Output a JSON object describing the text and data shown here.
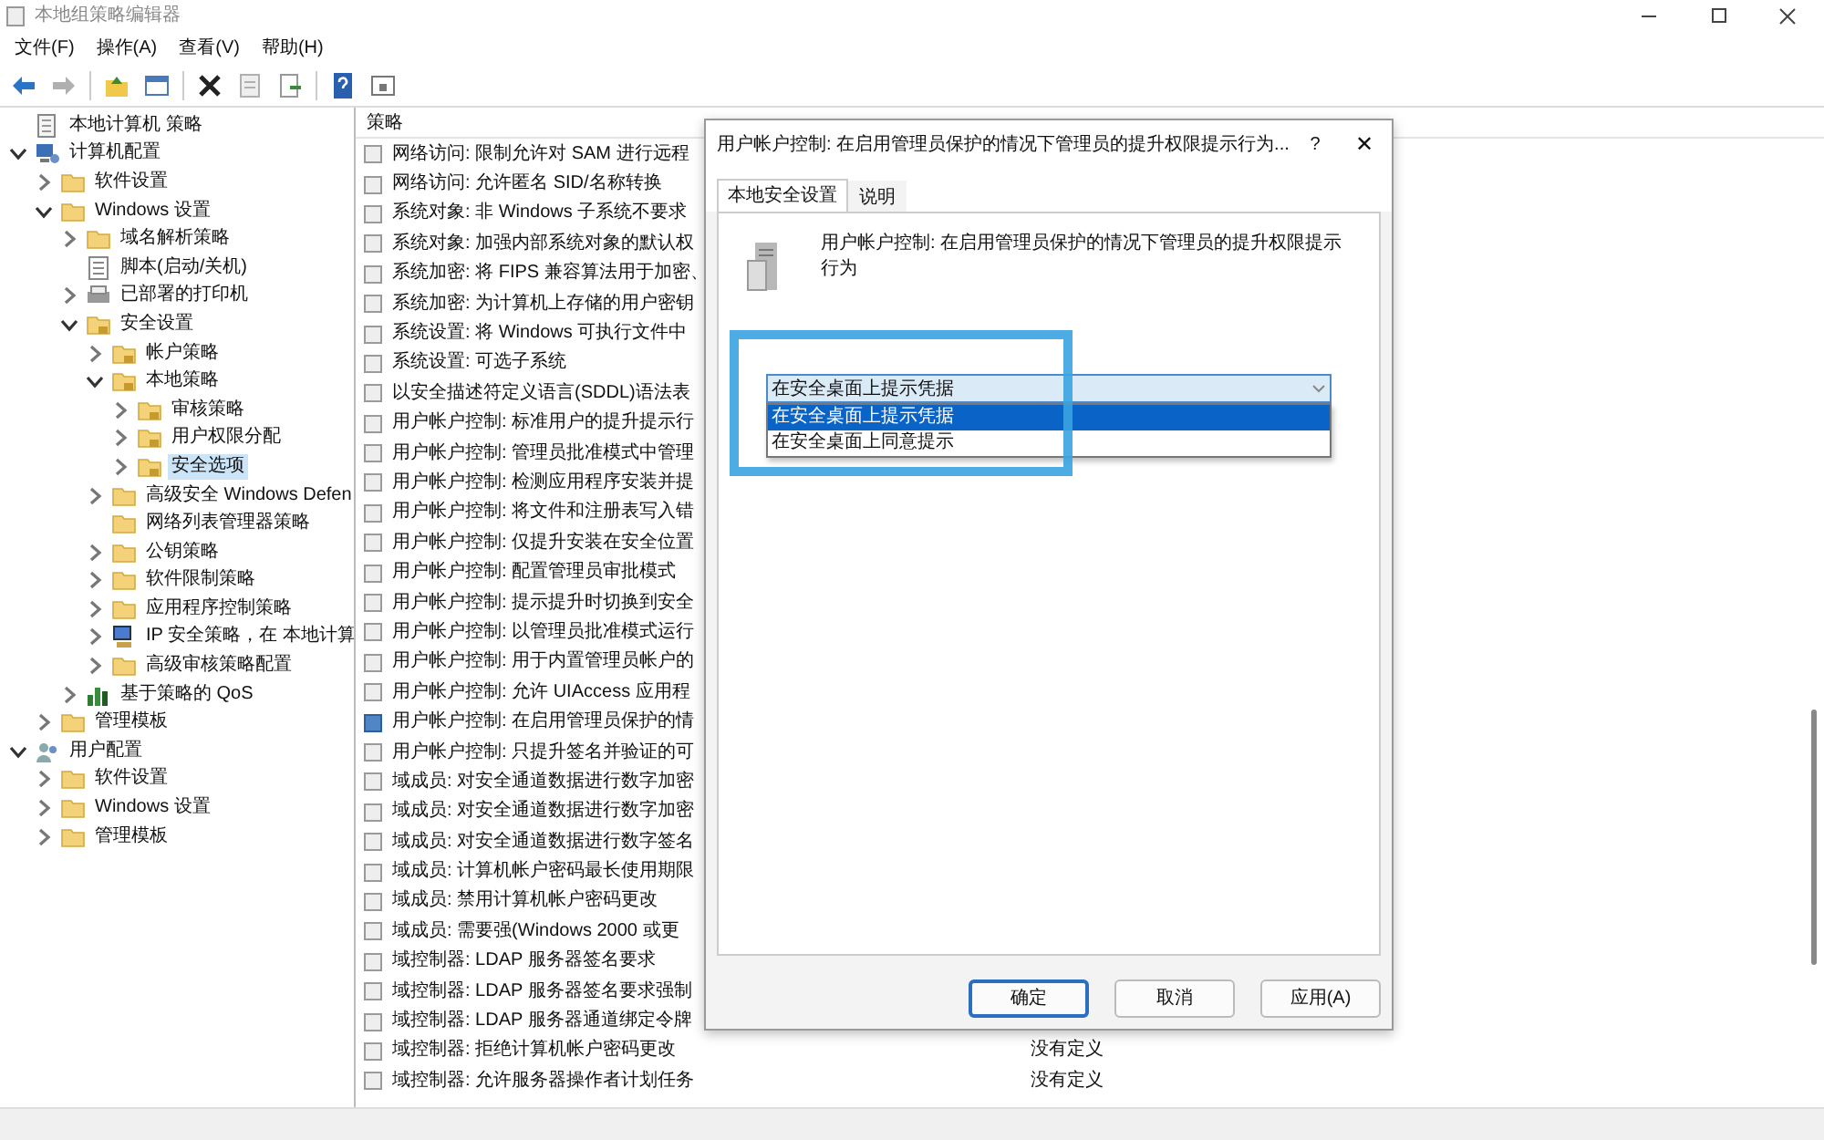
{
  "window": {
    "title": "本地组策略编辑器"
  },
  "menu": [
    "文件(F)",
    "操作(A)",
    "查看(V)",
    "帮助(H)"
  ],
  "toolbar": [
    {
      "kind": "back"
    },
    {
      "kind": "forward"
    },
    {
      "kind": "sep"
    },
    {
      "kind": "up"
    },
    {
      "kind": "tree"
    },
    {
      "kind": "sep"
    },
    {
      "kind": "delete"
    },
    {
      "kind": "properties"
    },
    {
      "kind": "export"
    },
    {
      "kind": "sep"
    },
    {
      "kind": "help"
    },
    {
      "kind": "pane"
    }
  ],
  "tree": [
    {
      "label": "本地计算机 策略",
      "kind": "policy",
      "selected": false
    },
    {
      "label": "计算机配置",
      "kind": "computer",
      "has_children": true,
      "expanded": true,
      "selected": false,
      "children": [
        {
          "label": "软件设置",
          "kind": "folder",
          "has_children": true,
          "expanded": false,
          "selected": false
        },
        {
          "label": "Windows 设置",
          "kind": "folder",
          "has_children": true,
          "expanded": true,
          "selected": false,
          "children": [
            {
              "label": "域名解析策略",
              "kind": "folder",
              "has_children": true,
              "expanded": false,
              "selected": false
            },
            {
              "label": "脚本(启动/关机)",
              "kind": "script",
              "selected": false
            },
            {
              "label": "已部署的打印机",
              "kind": "printer",
              "has_children": true,
              "expanded": false,
              "selected": false
            },
            {
              "label": "安全设置",
              "kind": "secure",
              "has_children": true,
              "expanded": true,
              "selected": false,
              "children": [
                {
                  "label": "帐户策略",
                  "kind": "secure",
                  "has_children": true,
                  "expanded": false,
                  "selected": false
                },
                {
                  "label": "本地策略",
                  "kind": "secure",
                  "has_children": true,
                  "expanded": true,
                  "selected": false,
                  "children": [
                    {
                      "label": "审核策略",
                      "kind": "secure",
                      "has_children": true,
                      "expanded": false,
                      "selected": false
                    },
                    {
                      "label": "用户权限分配",
                      "kind": "secure",
                      "has_children": true,
                      "expanded": false,
                      "selected": false
                    },
                    {
                      "label": "安全选项",
                      "kind": "secure",
                      "has_children": true,
                      "expanded": false,
                      "selected": true
                    }
                  ]
                },
                {
                  "label": "高级安全 Windows Defen",
                  "kind": "folder",
                  "has_children": true,
                  "expanded": false,
                  "selected": false
                },
                {
                  "label": "网络列表管理器策略",
                  "kind": "folder",
                  "selected": false
                },
                {
                  "label": "公钥策略",
                  "kind": "folder",
                  "has_children": true,
                  "expanded": false,
                  "selected": false
                },
                {
                  "label": "软件限制策略",
                  "kind": "folder",
                  "has_children": true,
                  "expanded": false,
                  "selected": false
                },
                {
                  "label": "应用程序控制策略",
                  "kind": "folder",
                  "has_children": true,
                  "expanded": false,
                  "selected": false
                },
                {
                  "label": "IP 安全策略，在 本地计算",
                  "kind": "ipsec",
                  "has_children": true,
                  "expanded": false,
                  "selected": false
                },
                {
                  "label": "高级审核策略配置",
                  "kind": "folder",
                  "has_children": true,
                  "expanded": false,
                  "selected": false
                }
              ]
            },
            {
              "label": "基于策略的 QoS",
              "kind": "qos",
              "has_children": true,
              "expanded": false,
              "selected": false
            }
          ]
        },
        {
          "label": "管理模板",
          "kind": "folder",
          "has_children": true,
          "expanded": false,
          "selected": false
        }
      ]
    },
    {
      "label": "用户配置",
      "kind": "user",
      "has_children": true,
      "expanded": true,
      "selected": false,
      "children": [
        {
          "label": "软件设置",
          "kind": "folder",
          "has_children": true,
          "expanded": false,
          "selected": false
        },
        {
          "label": "Windows 设置",
          "kind": "folder",
          "has_children": true,
          "expanded": false,
          "selected": false
        },
        {
          "label": "管理模板",
          "kind": "folder",
          "has_children": true,
          "expanded": false,
          "selected": false
        }
      ]
    }
  ],
  "policy_list": {
    "column_header": "策略",
    "rows": [
      {
        "name": "网络访问: 限制允许对 SAM 进行远程",
        "selected": false
      },
      {
        "name": "网络访问: 允许匿名 SID/名称转换",
        "selected": false
      },
      {
        "name": "系统对象: 非 Windows 子系统不要求",
        "selected": false
      },
      {
        "name": "系统对象: 加强内部系统对象的默认权",
        "selected": false
      },
      {
        "name": "系统加密: 将 FIPS 兼容算法用于加密、",
        "selected": false
      },
      {
        "name": "系统加密: 为计算机上存储的用户密钥",
        "selected": false
      },
      {
        "name": "系统设置: 将 Windows 可执行文件中",
        "selected": false
      },
      {
        "name": "系统设置: 可选子系统",
        "selected": false
      },
      {
        "name": "以安全描述符定义语言(SDDL)语法表",
        "selected": false
      },
      {
        "name": "用户帐户控制: 标准用户的提升提示行",
        "selected": false
      },
      {
        "name": "用户帐户控制: 管理员批准模式中管理",
        "selected": false
      },
      {
        "name": "用户帐户控制: 检测应用程序安装并提",
        "selected": false
      },
      {
        "name": "用户帐户控制: 将文件和注册表写入错",
        "selected": false
      },
      {
        "name": "用户帐户控制: 仅提升安装在安全位置",
        "selected": false
      },
      {
        "name": "用户帐户控制:  配置管理员审批模式",
        "selected": false
      },
      {
        "name": "用户帐户控制: 提示提升时切换到安全",
        "selected": false
      },
      {
        "name": "用户帐户控制: 以管理员批准模式运行",
        "selected": false
      },
      {
        "name": "用户帐户控制: 用于内置管理员帐户的",
        "selected": false
      },
      {
        "name": "用户帐户控制: 允许 UIAccess 应用程",
        "selected": false
      },
      {
        "name": "用户帐户控制: 在启用管理员保护的情",
        "selected": true
      },
      {
        "name": "用户帐户控制: 只提升签名并验证的可",
        "selected": false
      },
      {
        "name": "域成员: 对安全通道数据进行数字加密",
        "selected": false
      },
      {
        "name": "域成员: 对安全通道数据进行数字加密",
        "selected": false
      },
      {
        "name": "域成员: 对安全通道数据进行数字签名",
        "selected": false
      },
      {
        "name": "域成员: 计算机帐户密码最长使用期限",
        "selected": false
      },
      {
        "name": "域成员: 禁用计算机帐户密码更改",
        "selected": false
      },
      {
        "name": "域成员: 需要强(Windows 2000 或更",
        "selected": false
      },
      {
        "name": "域控制器: LDAP 服务器签名要求",
        "selected": false
      },
      {
        "name": "域控制器: LDAP 服务器签名要求强制",
        "selected": false
      },
      {
        "name": "域控制器: LDAP 服务器通道绑定令牌",
        "selected": false
      },
      {
        "name": "域控制器: 拒绝计算机帐户密码更改",
        "selected": false,
        "setting": "没有定义"
      },
      {
        "name": "域控制器: 允许服务器操作者计划任务",
        "selected": false,
        "setting": "没有定义"
      }
    ]
  },
  "dialog": {
    "title": "用户帐户控制: 在启用管理员保护的情况下管理员的提升权限提示行为...",
    "help": "?",
    "close": "✕",
    "tabs": [
      {
        "label": "本地安全设置",
        "selected": true
      },
      {
        "label": "说明",
        "selected": false
      }
    ],
    "description": "用户帐户控制: 在启用管理员保护的情况下管理员的提升权限提示行为",
    "dropdown": {
      "value": "在安全桌面上提示凭据",
      "expanded": true,
      "options": [
        {
          "label": "在安全桌面上提示凭据",
          "selected": true
        },
        {
          "label": "在安全桌面上同意提示",
          "selected": false
        }
      ]
    },
    "buttons": [
      {
        "label": "确定",
        "default": true
      },
      {
        "label": "取消",
        "default": false
      },
      {
        "label": "应用(A)",
        "default": false
      }
    ]
  }
}
